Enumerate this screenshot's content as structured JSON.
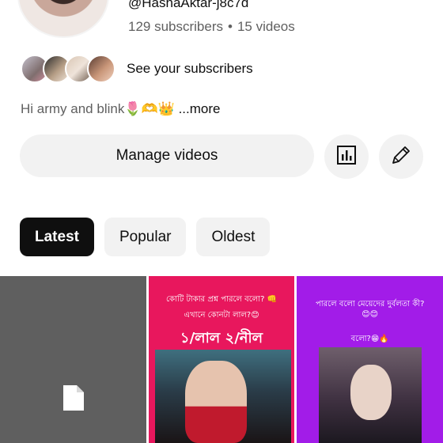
{
  "profile": {
    "handle": "@HashaAktar-j8c7d",
    "subscribers": "129 subscribers",
    "separator": "•",
    "videos": "15 videos",
    "see_subscribers": "See your subscribers",
    "bio": "Hi army and blink🌷🫶👑",
    "more": "...more"
  },
  "actions": {
    "manage_videos": "Manage videos"
  },
  "tabs": [
    {
      "label": "Latest",
      "selected": true
    },
    {
      "label": "Popular",
      "selected": false
    },
    {
      "label": "Oldest",
      "selected": false
    }
  ],
  "videos": [
    {
      "thumbnail": "placeholder-file-icon"
    },
    {
      "line1": "কোটি টাকার প্রশ্ন পারলে বলো? 👊",
      "line2": "এখানে কোনটা লাল?😊",
      "options": "১/লাল  ২/নীল"
    },
    {
      "line1": "পারলে বলো মেয়েদের দুর্বলতা কী?",
      "line2": "😊😊",
      "line3": "বলো?😁🔥"
    }
  ],
  "colors": {
    "tab_active_bg": "#0f0f0f",
    "button_bg": "#f2f2f2",
    "thumb_pink": "#e8175d",
    "thumb_purple": "#a21ce8",
    "thumb_gray": "#5f5f5f"
  }
}
